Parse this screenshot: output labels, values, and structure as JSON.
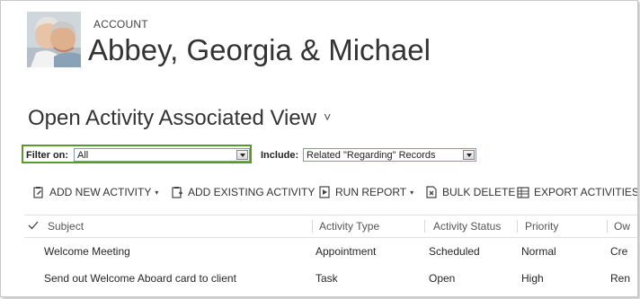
{
  "header": {
    "entity_label": "ACCOUNT",
    "record_name": "Abbey, Georgia & Michael"
  },
  "view": {
    "title": "Open Activity Associated View",
    "chevron": "˅"
  },
  "filters": {
    "filter_label": "Filter on:",
    "filter_value": "All",
    "include_label": "Include:",
    "include_value": "Related \"Regarding\" Records",
    "highlight_color": "#5a9a2a"
  },
  "toolbar": {
    "add_new_activity": "ADD NEW ACTIVITY",
    "add_existing_activity": "ADD EXISTING ACTIVITY",
    "run_report": "RUN REPORT",
    "bulk_delete": "BULK DELETE",
    "export_activities": "EXPORT ACTIVITIES",
    "dropdown_glyph": "▾"
  },
  "grid": {
    "columns": [
      "Subject",
      "Activity Type",
      "Activity Status",
      "Priority",
      "Ow"
    ],
    "rows": [
      [
        "Welcome Meeting",
        "Appointment",
        "Scheduled",
        "Normal",
        "Cre"
      ],
      [
        "Send out Welcome Aboard card to client",
        "Task",
        "Open",
        "High",
        "Ren"
      ]
    ]
  }
}
